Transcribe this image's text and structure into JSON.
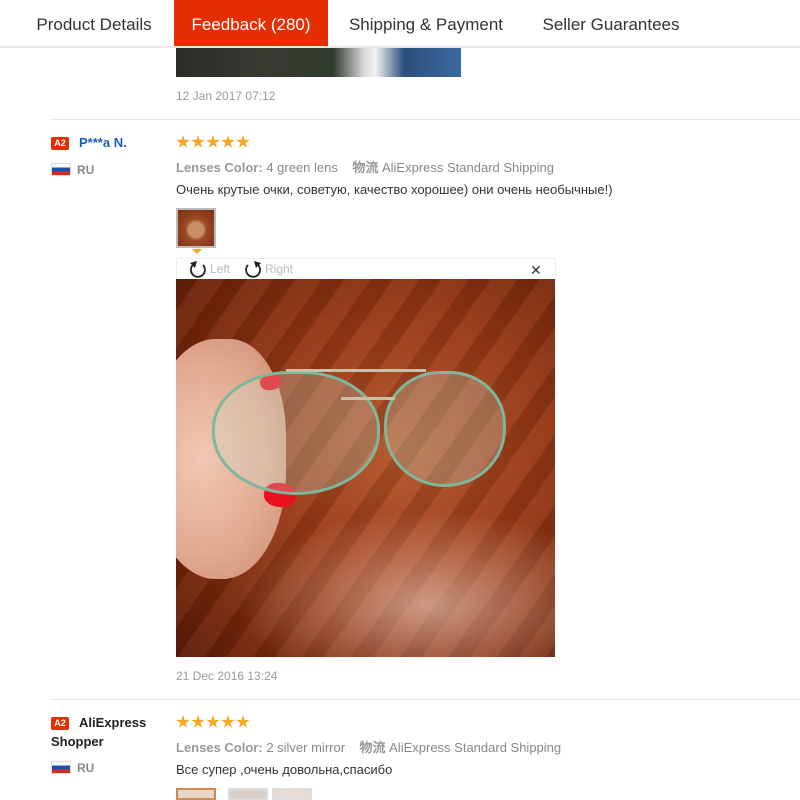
{
  "tabs": [
    {
      "label": "Product Details",
      "active": false
    },
    {
      "label": "Feedback (280)",
      "active": true
    },
    {
      "label": "Shipping & Payment",
      "active": false
    },
    {
      "label": "Seller Guarantees",
      "active": false
    }
  ],
  "previous_review": {
    "date": "12 Jan 2017 07:12"
  },
  "reviews": [
    {
      "badge": "A2",
      "user": "P***a N.",
      "country": "RU",
      "rating": 5,
      "option_label": "Lenses Color:",
      "option_value": "4 green lens",
      "shipping_icon": "物流",
      "shipping": "AliExpress Standard Shipping",
      "text": "Очень крутые очки, советую, качество хорошее) они очень необычные!)",
      "viewer": {
        "rotate_left": "Left",
        "rotate_right": "Right"
      },
      "date": "21 Dec 2016 13:24"
    },
    {
      "badge": "A2",
      "user_line1": "AliExpress",
      "user_line2": "Shopper",
      "country": "RU",
      "rating": 5,
      "option_label": "Lenses Color:",
      "option_value": "2 silver mirror",
      "shipping_icon": "物流",
      "shipping": "AliExpress Standard Shipping",
      "text": "Все супер ,очень довольна,спасибо"
    }
  ],
  "colors": {
    "accent": "#e62e04",
    "star": "#f5a623",
    "link": "#1a5fb4"
  }
}
